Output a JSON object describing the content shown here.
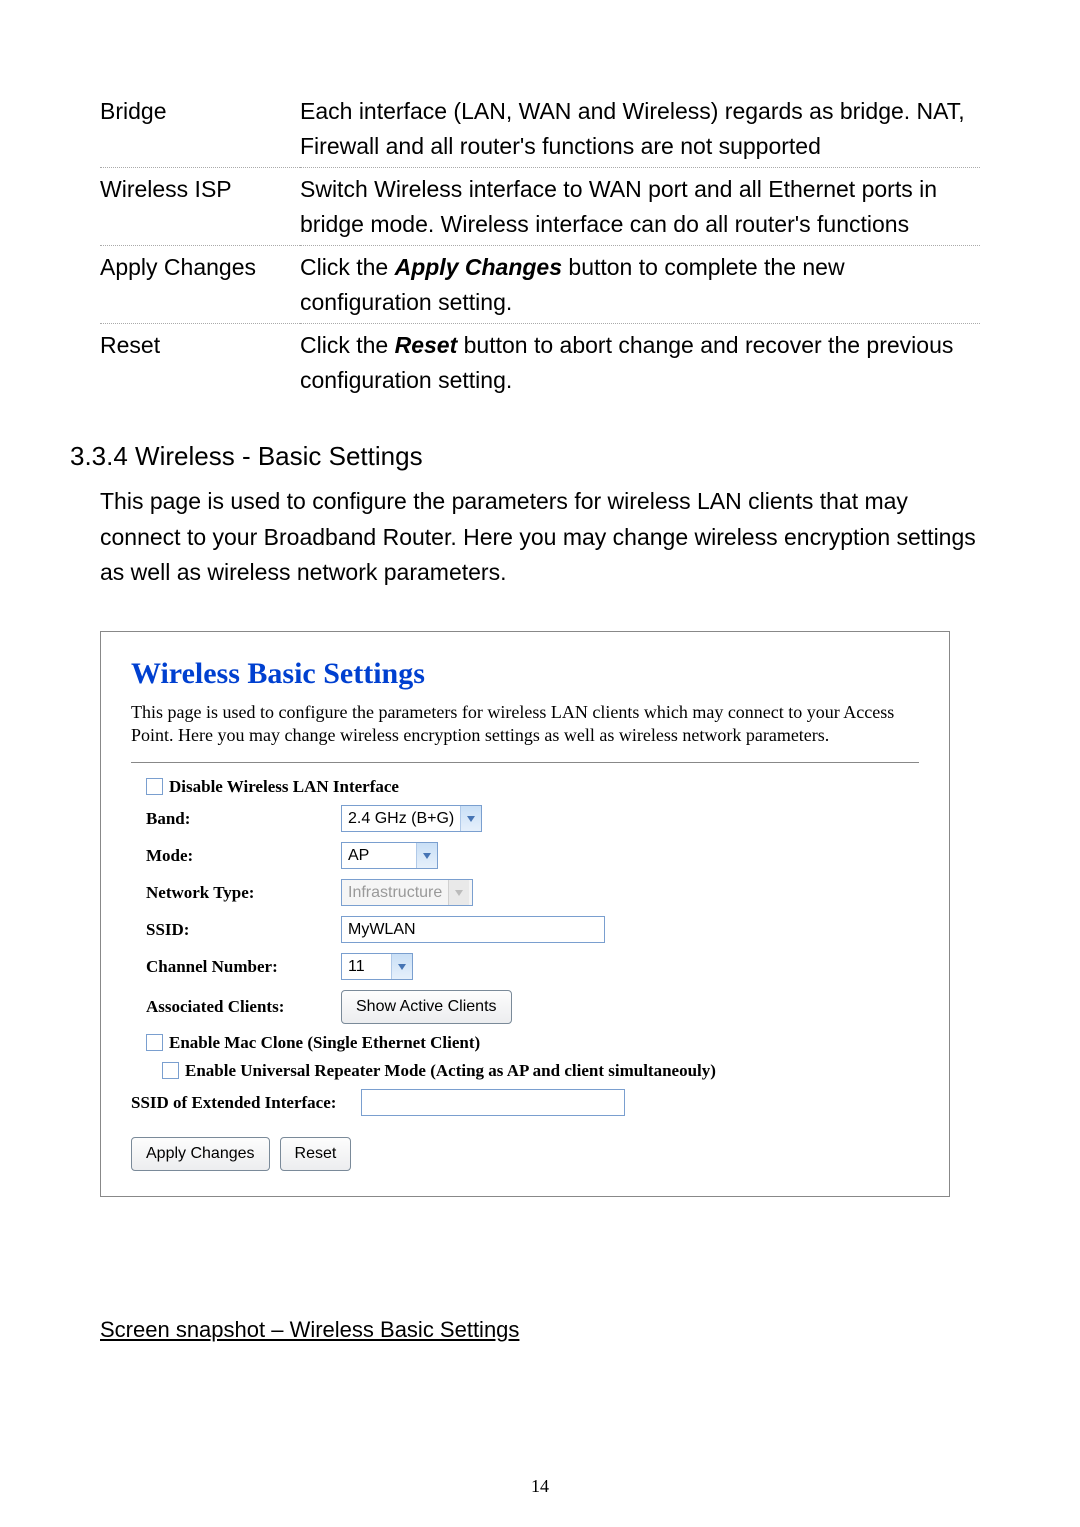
{
  "table": {
    "rows": [
      {
        "term": "Bridge",
        "desc": "Each interface (LAN, WAN and Wireless) regards as bridge. NAT, Firewall and all router's functions are not supported"
      },
      {
        "term": "Wireless ISP",
        "desc": "Switch Wireless interface to WAN port and all Ethernet ports in bridge mode. Wireless interface can do all router's functions"
      },
      {
        "term": "Apply Changes",
        "desc_pre": "Click the ",
        "desc_bold": "Apply Changes",
        "desc_post": " button to complete the new configuration setting."
      },
      {
        "term": "Reset",
        "desc_pre": "Click the ",
        "desc_bold": "Reset",
        "desc_post": " button to abort change and recover the previous configuration setting."
      }
    ]
  },
  "section": {
    "heading": "3.3.4 Wireless - Basic Settings",
    "intro": "This page is used to configure the parameters for wireless LAN clients that may connect to your Broadband Router. Here you may change wireless encryption settings as well as wireless network parameters."
  },
  "panel": {
    "title": "Wireless Basic Settings",
    "desc": "This page is used to configure the parameters for wireless LAN clients which may connect to your Access Point. Here you may change wireless encryption settings as well as wireless network parameters.",
    "disable_wlan": "Disable Wireless LAN Interface",
    "band_label": "Band:",
    "band_value": "2.4 GHz (B+G)",
    "mode_label": "Mode:",
    "mode_value": "AP",
    "nettype_label": "Network Type:",
    "nettype_value": "Infrastructure",
    "ssid_label": "SSID:",
    "ssid_value": "MyWLAN",
    "channel_label": "Channel Number:",
    "channel_value": "11",
    "assoc_label": "Associated Clients:",
    "assoc_btn": "Show Active Clients",
    "mac_clone": "Enable Mac Clone (Single Ethernet Client)",
    "univ_repeater": "Enable Universal Repeater Mode (Acting as AP and client simultaneouly)",
    "ext_ssid_label": "SSID of Extended Interface:",
    "apply_btn": "Apply Changes",
    "reset_btn": "Reset"
  },
  "snapshot_caption": "Screen snapshot – Wireless Basic Settings",
  "page_number": "14"
}
